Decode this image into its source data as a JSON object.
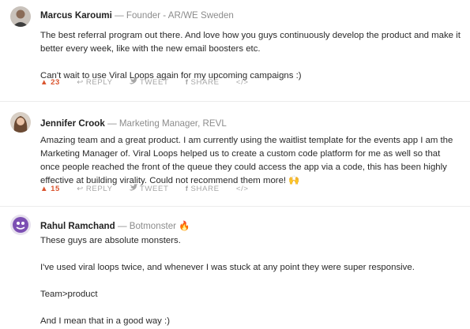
{
  "comments": [
    {
      "name": "Marcus Karoumi",
      "role": "— Founder - AR/WE Sweden",
      "paragraphs": [
        "The best referral program out there. And love how you guys continuously develop the product and make it better every week, like with the new email boosters etc.",
        "Can't wait to use Viral Loops again for my upcoming campaigns :)"
      ],
      "actions": {
        "upvotes": "23",
        "reply": "REPLY",
        "tweet": "TWEET",
        "share": "SHARE"
      }
    },
    {
      "name": "Jennifer Crook",
      "role": "— Marketing Manager, REVL",
      "paragraphs": [
        "Amazing team and a great product. I am currently using the waitlist template for the events app I am the Marketing Manager of. Viral Loops helped us to create a custom code platform for me as well so that once people reached the front of the queue they could access the app via a code, this has been highly effective at building virality. Could not recommend them more! 🙌"
      ],
      "actions": {
        "upvotes": "15",
        "reply": "REPLY",
        "tweet": "TWEET",
        "share": "SHARE"
      }
    },
    {
      "name": "Rahul Ramchand",
      "role": "— Botmonster 🔥",
      "paragraphs": [
        "These guys are absolute monsters.",
        "I've used viral loops twice, and whenever I was stuck at any point they were super responsive.",
        "Team>product",
        "And I mean that in a good way :)"
      ]
    }
  ],
  "colors": {
    "upvote": "#da552f",
    "muted": "#a6a6a6",
    "role": "#8c8c8c"
  },
  "icons": {
    "upvote": "triangle-up-icon",
    "reply": "reply-arrow-icon",
    "tweet": "twitter-bird-icon",
    "share": "facebook-f-icon",
    "embed": "code-brackets-icon"
  }
}
